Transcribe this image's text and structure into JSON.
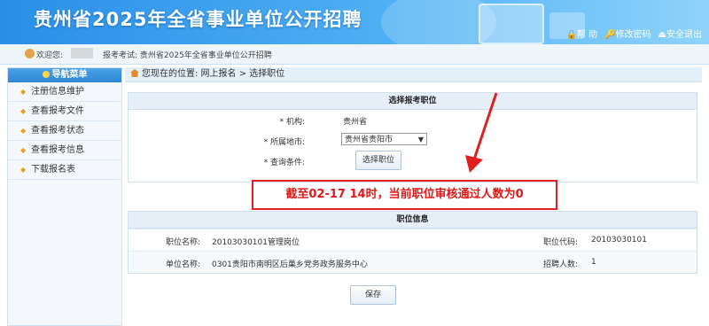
{
  "header": {
    "title": "贵州省2025年全省事业单位公开招聘",
    "links": [
      {
        "icon": "lock-icon",
        "label": "帮 助"
      },
      {
        "icon": "key-icon",
        "label": "修改密码"
      },
      {
        "icon": "exit-icon",
        "label": "安全退出"
      }
    ]
  },
  "infobar": {
    "welcome": "欢迎您:",
    "exam": "报考考试:  贵州省2025年全省事业单位公开招聘"
  },
  "sidebar": {
    "title": "导航菜单",
    "items": [
      "注册信息维护",
      "查看报考文件",
      "查看报考状态",
      "查看报考信息",
      "下载报名表"
    ]
  },
  "breadcrumb": "您现在的位置:  网上报名  >  选择职位",
  "select_panel": {
    "title": "选择报考职位",
    "org_label": "* 机构:",
    "org_value": "贵州省",
    "region_label": "* 所属地市:",
    "region_value": "贵州省贵阳市",
    "query_label": "* 查询条件:",
    "query_button": "选择职位"
  },
  "alert": "截至02-17 14时，当前职位审核通过人数为0",
  "position_info": {
    "title": "职位信息",
    "name_label": "职位名称:",
    "name_value": "20103030101管理岗位",
    "code_label": "职位代码:",
    "code_value": "20103030101",
    "unit_label": "单位名称:",
    "unit_value": "0301贵阳市南明区后巢乡党务政务服务中心",
    "count_label": "招聘人数:",
    "count_value": "1"
  },
  "save_button": "保存",
  "colors": {
    "banner": "#2a8ee8",
    "alert_red": "#e01818"
  }
}
